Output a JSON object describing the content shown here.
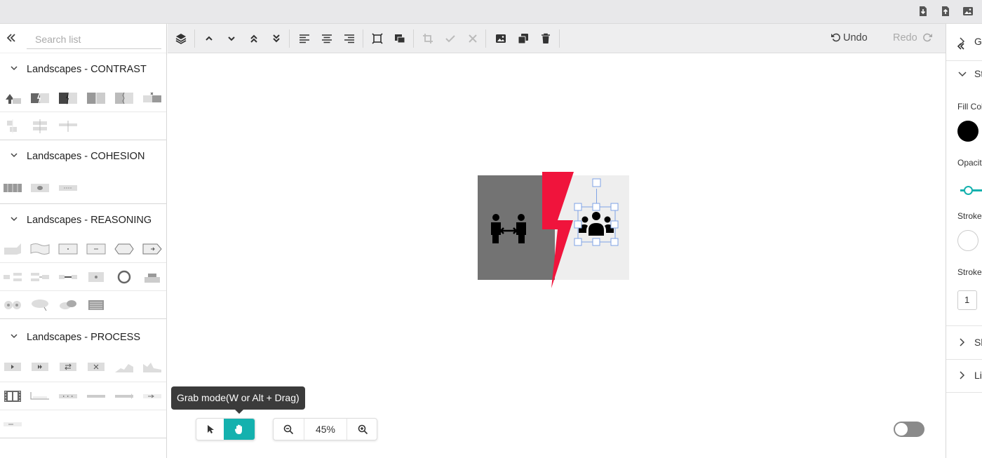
{
  "sidebar": {
    "search_placeholder": "Search list",
    "sections": [
      {
        "title": "Landscapes - CONTRAST"
      },
      {
        "title": "Landscapes - COHESION"
      },
      {
        "title": "Landscapes - REASONING"
      },
      {
        "title": "Landscapes - PROCESS"
      }
    ]
  },
  "toolbar": {
    "undo_label": "Undo",
    "redo_label": "Redo"
  },
  "right_panel": {
    "sections": [
      "Gl",
      "St",
      "Sh",
      "Li"
    ],
    "fill_color_label": "Fill Col",
    "fill_color": "#000000",
    "opacity_label": "Opacit",
    "stroke_label": "Stroke",
    "stroke_color": "#ffffff",
    "stroke_width_label": "Stroke",
    "stroke_width_value": "1"
  },
  "bottom": {
    "tooltip": "Grab mode(W or Alt + Drag)",
    "zoom_level": "45%"
  },
  "colors": {
    "accent": "#14b1ae",
    "lightning": "#f0143c",
    "dark_panel": "#737373",
    "light_panel": "#eeeeee"
  }
}
